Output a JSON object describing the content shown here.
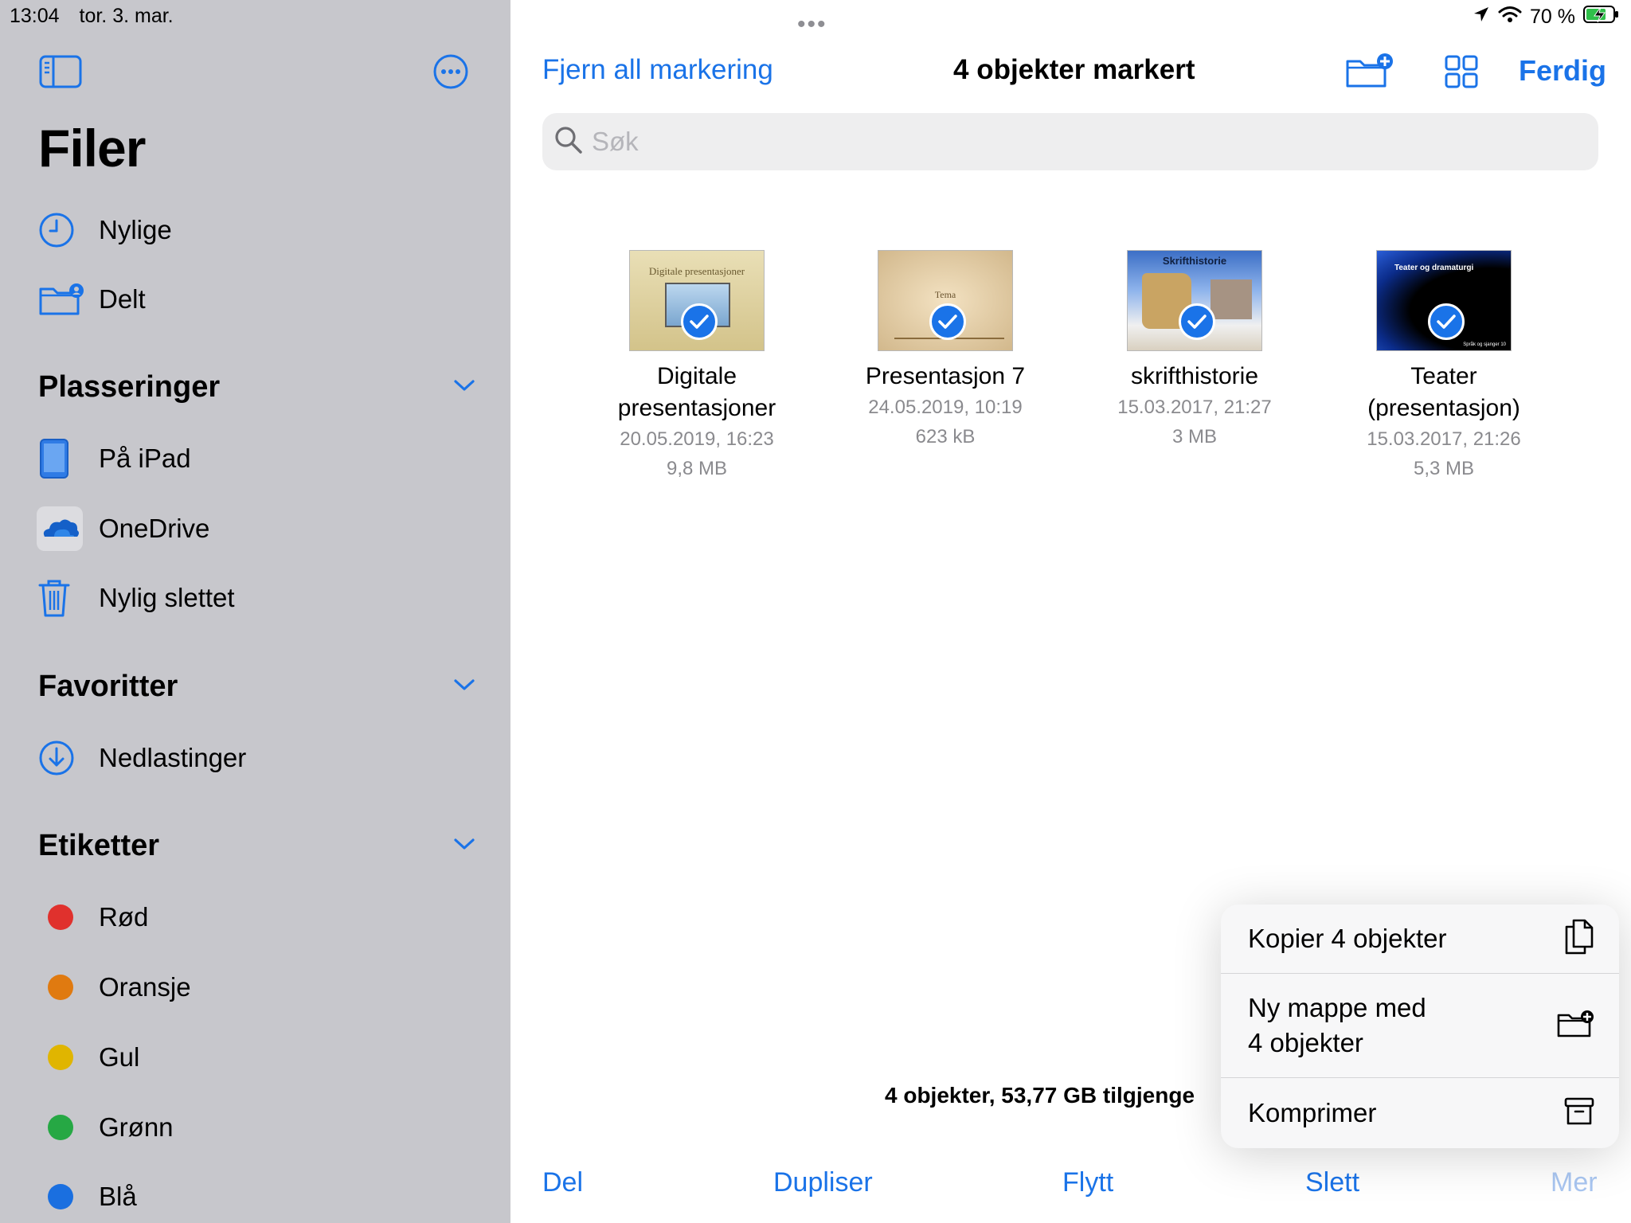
{
  "status": {
    "time": "13:04",
    "date": "tor. 3. mar.",
    "battery": "70 %"
  },
  "sidebar": {
    "title": "Filer",
    "top_items": [
      {
        "label": "Nylige",
        "icon": "clock-icon"
      },
      {
        "label": "Delt",
        "icon": "shared-folder-icon"
      }
    ],
    "sections": {
      "locations": {
        "title": "Plasseringer",
        "items": [
          {
            "label": "På iPad",
            "icon": "ipad-icon"
          },
          {
            "label": "OneDrive",
            "icon": "onedrive-icon"
          },
          {
            "label": "Nylig slettet",
            "icon": "trash-icon"
          }
        ]
      },
      "favorites": {
        "title": "Favoritter",
        "items": [
          {
            "label": "Nedlastinger",
            "icon": "download-icon"
          }
        ]
      },
      "tags": {
        "title": "Etiketter",
        "items": [
          {
            "label": "Rød",
            "color": "#e0312d"
          },
          {
            "label": "Oransje",
            "color": "#e07a10"
          },
          {
            "label": "Gul",
            "color": "#e0b500"
          },
          {
            "label": "Grønn",
            "color": "#26a844"
          },
          {
            "label": "Blå",
            "color": "#1a6fe0"
          }
        ]
      }
    }
  },
  "nav": {
    "deselect_all": "Fjern all markering",
    "title": "4 objekter markert",
    "done": "Ferdig"
  },
  "search": {
    "placeholder": "Søk"
  },
  "files": [
    {
      "name_line1": "Digitale",
      "name_line2": "presentasjoner",
      "date": "20.05.2019, 16:23",
      "size": "9,8 MB",
      "thumb_text": "Digitale presentasjoner",
      "selected": true
    },
    {
      "name_line1": "Presentasjon 7",
      "name_line2": "",
      "date": "24.05.2019, 10:19",
      "size": "623 kB",
      "thumb_text": "Tema",
      "selected": true
    },
    {
      "name_line1": "skrifthistorie",
      "name_line2": "",
      "date": "15.03.2017, 21:27",
      "size": "3 MB",
      "thumb_text": "Skrifthistorie",
      "selected": true
    },
    {
      "name_line1": "Teater",
      "name_line2": "(presentasjon)",
      "date": "15.03.2017, 21:26",
      "size": "5,3 MB",
      "thumb_text": "Teater og dramaturgi",
      "thumb_footer": "Språk og sjanger 10",
      "selected": true
    }
  ],
  "storage_info": "4 objekter, 53,77 GB tilgjenge",
  "toolbar": {
    "share": "Del",
    "duplicate": "Dupliser",
    "move": "Flytt",
    "delete": "Slett",
    "more": "Mer"
  },
  "context_menu": {
    "items": [
      {
        "label": "Kopier 4 objekter",
        "icon": "copy-icon"
      },
      {
        "label_line1": "Ny mappe med",
        "label_line2": "4 objekter",
        "icon": "new-folder-icon"
      },
      {
        "label": "Komprimer",
        "icon": "archive-icon"
      }
    ]
  },
  "colors": {
    "accent": "#1a73e8",
    "sidebar_bg": "#c7c7cc"
  }
}
